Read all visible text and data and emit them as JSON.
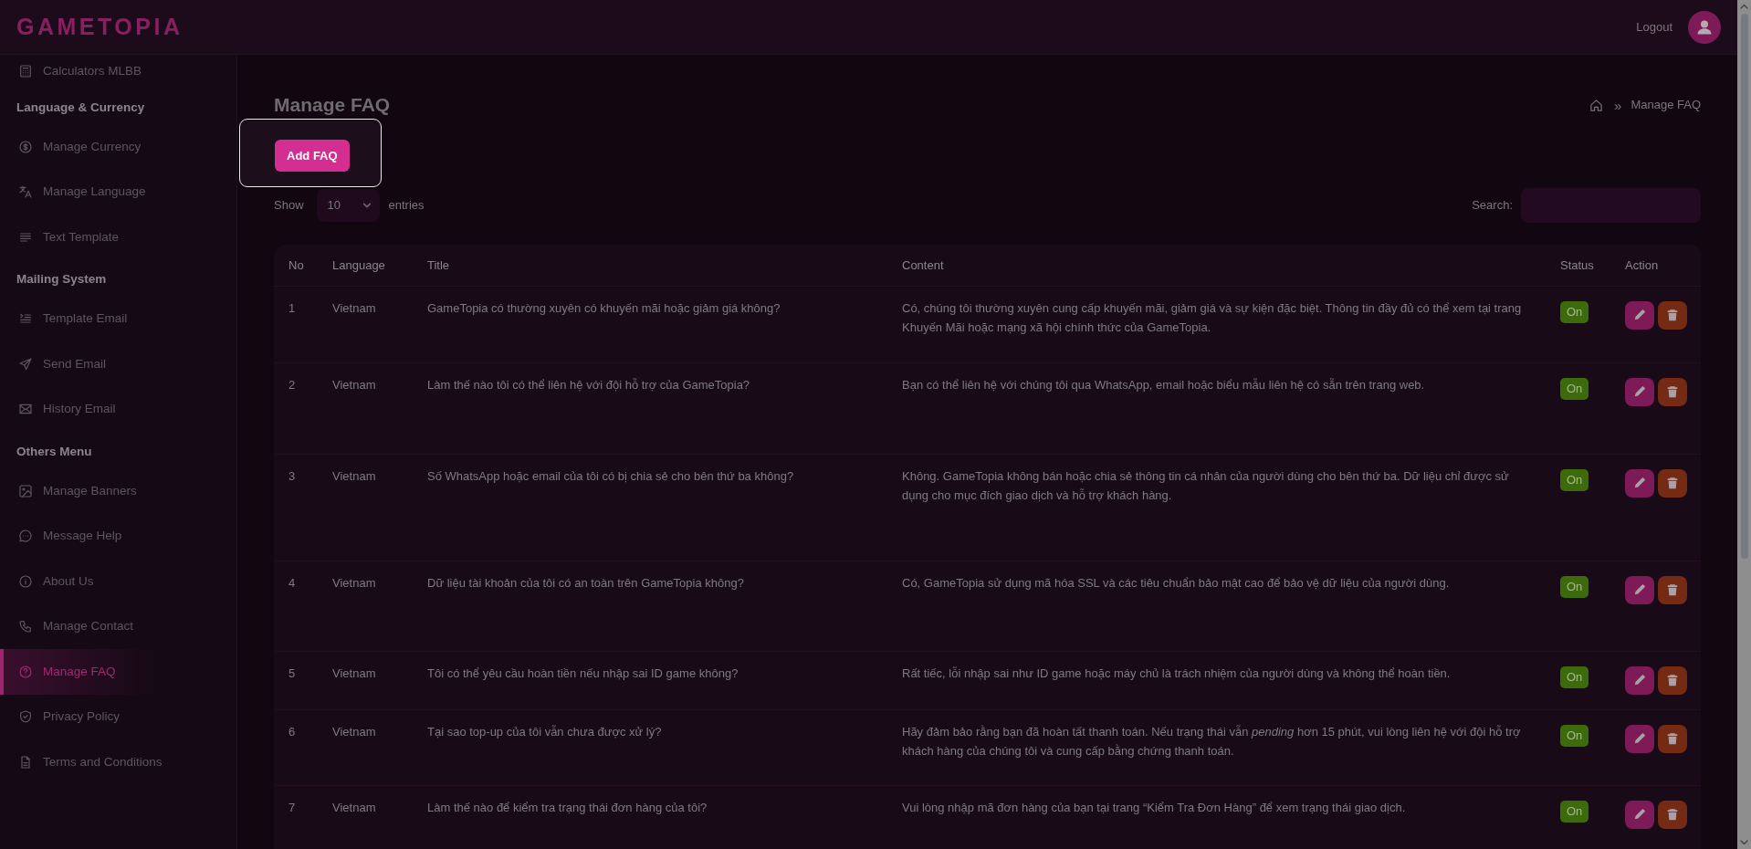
{
  "header": {
    "logo": "GAMETOPIA",
    "logout": "Logout"
  },
  "sidebar": {
    "groups": [
      {
        "items": [
          {
            "label": "Calculators MLBB",
            "selected": false
          }
        ]
      },
      {
        "heading": "Language & Currency",
        "items": [
          {
            "label": "Manage Currency",
            "selected": false
          },
          {
            "label": "Manage Language",
            "selected": false
          },
          {
            "label": "Text Template",
            "selected": false
          }
        ]
      },
      {
        "heading": "Mailing System",
        "items": [
          {
            "label": "Template Email",
            "selected": false
          },
          {
            "label": "Send Email",
            "selected": false
          },
          {
            "label": "History Email",
            "selected": false
          }
        ]
      },
      {
        "heading": "Others Menu",
        "items": [
          {
            "label": "Manage Banners",
            "selected": false
          },
          {
            "label": "Message Help",
            "selected": false
          },
          {
            "label": "About Us",
            "selected": false
          },
          {
            "label": "Manage Contact",
            "selected": false
          },
          {
            "label": "Manage FAQ",
            "selected": true
          },
          {
            "label": "Privacy Policy",
            "selected": false
          },
          {
            "label": "Terms and Conditions",
            "selected": false
          }
        ]
      }
    ]
  },
  "page": {
    "title": "Manage FAQ",
    "breadcrumb": {
      "separator": "»",
      "current": "Manage FAQ"
    }
  },
  "add_button": {
    "label": "Add FAQ",
    "highlighted": true
  },
  "entries": {
    "show": "Show",
    "value": "10",
    "suffix": "entries"
  },
  "search": {
    "label": "Search:"
  },
  "table": {
    "columns": [
      "No",
      "Language",
      "Title",
      "Content",
      "Status",
      "Action"
    ],
    "rows": [
      {
        "no": "1",
        "language": "Vietnam",
        "title": "GameTopia có thường xuyên có khuyến mãi hoặc giảm giá không?",
        "content": "Có, chúng tôi thường xuyên cung cấp khuyến mãi, giảm giá và sự kiện đặc biệt. Thông tin đầy đủ có thể xem tại trang Khuyến Mãi hoặc mạng xã hội chính thức của GameTopia.",
        "status": {
          "label": "On",
          "on": true
        }
      },
      {
        "no": "2",
        "language": "Vietnam",
        "title": "Làm thế nào tôi có thể liên hệ với đội hỗ trợ của GameTopia?",
        "content": "Bạn có thể liên hệ với chúng tôi qua WhatsApp, email hoặc biểu mẫu liên hệ có sẵn trên trang web.",
        "status": {
          "label": "On",
          "on": true
        }
      },
      {
        "no": "3",
        "language": "Vietnam",
        "title": "Số WhatsApp hoặc email của tôi có bị chia sẻ cho bên thứ ba không?",
        "content": "Không. GameTopia không bán hoặc chia sẻ thông tin cá nhân của người dùng cho bên thứ ba. Dữ liệu chỉ được sử dụng cho mục đích giao dịch và hỗ trợ khách hàng.",
        "status": {
          "label": "On",
          "on": true
        }
      },
      {
        "no": "4",
        "language": "Vietnam",
        "title": "Dữ liệu tài khoản của tôi có an toàn trên GameTopia không?",
        "content": "Có, GameTopia sử dụng mã hóa SSL và các tiêu chuẩn bảo mật cao để bảo vệ dữ liệu của người dùng.",
        "status": {
          "label": "On",
          "on": true
        }
      },
      {
        "no": "5",
        "language": "Vietnam",
        "title": "Tôi có thể yêu cầu hoàn tiền nếu nhập sai ID game không?",
        "content": "Rất tiếc, lỗi nhập sai như ID game hoặc máy chủ là trách nhiệm của người dùng và không thể hoàn tiền.",
        "status": {
          "label": "On",
          "on": true
        }
      },
      {
        "no": "6",
        "language": "Vietnam",
        "title": "Tại sao top-up của tôi vẫn chưa được xử lý?",
        "content": "Hãy đảm bảo rằng bạn đã hoàn tất thanh toán. Nếu trạng thái vẫn *pending* hơn 15 phút, vui lòng liên hệ với đội hỗ trợ khách hàng của chúng tôi và cung cấp bằng chứng thanh toán.",
        "status": {
          "label": "On",
          "on": true
        }
      },
      {
        "no": "7",
        "language": "Vietnam",
        "title": "Làm thế nào để kiểm tra trạng thái đơn hàng của tôi?",
        "content": "Vui lòng nhập mã đơn hàng của bạn tại trang “Kiểm Tra Đơn Hàng” để xem trạng thái giao dịch.",
        "status": {
          "label": "On",
          "on": true
        }
      }
    ]
  }
}
